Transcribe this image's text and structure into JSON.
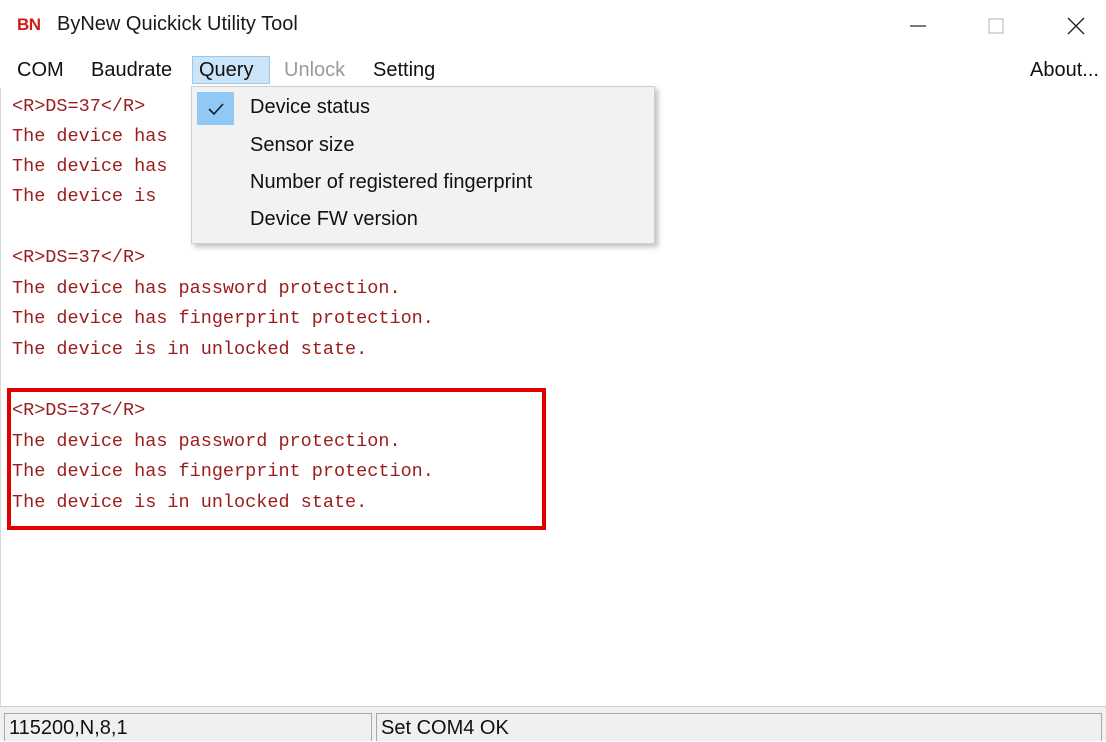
{
  "window": {
    "logo": "BN",
    "title": "ByNew Quickick Utility Tool"
  },
  "menu": {
    "com": "COM",
    "baudrate": "Baudrate",
    "query": "Query",
    "unlock": "Unlock",
    "setting": "Setting",
    "about": "About..."
  },
  "query_menu": {
    "items": [
      {
        "label": "Device status",
        "checked": true
      },
      {
        "label": "Sensor size",
        "checked": false
      },
      {
        "label": "Number of registered fingerprint",
        "checked": false
      },
      {
        "label": "Device FW version",
        "checked": false
      }
    ]
  },
  "output": {
    "lines": [
      "<R>DS=37</R>",
      "The device has",
      "The device has",
      "The device is",
      "",
      "<R>DS=37</R>",
      "The device has password protection.",
      "The device has fingerprint protection.",
      "The device is in unlocked state.",
      "",
      "<R>DS=37</R>",
      "The device has password protection.",
      "The device has fingerprint protection.",
      "The device is in unlocked state."
    ]
  },
  "status": {
    "port_settings": "115200,N,8,1",
    "message": "Set COM4 OK"
  },
  "colors": {
    "output_text": "#9b1c1c",
    "highlight": "#e00000",
    "logo": "#d11a1a",
    "menu_active_bg": "#cce4f7",
    "check_bg": "#90c8f6"
  },
  "icons": {
    "minimize": "minimize-icon",
    "maximize": "maximize-icon",
    "close": "close-icon",
    "check": "checkmark-icon"
  }
}
